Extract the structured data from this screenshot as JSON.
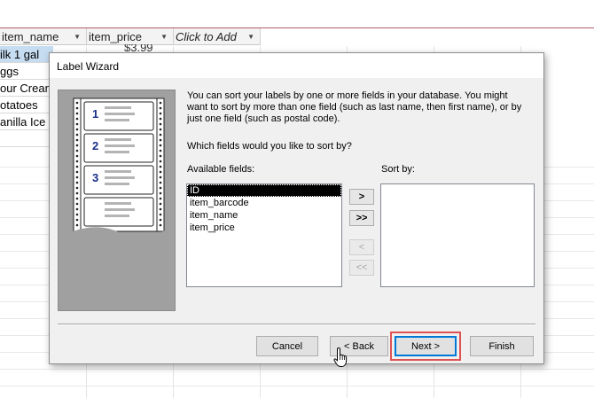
{
  "datasheet": {
    "columns": [
      {
        "label": "item_name",
        "italic": false
      },
      {
        "label": "item_price",
        "italic": false
      },
      {
        "label": "Click to Add",
        "italic": true
      }
    ],
    "rows": [
      "ilk 1 gal",
      "ggs",
      "our Cream",
      "otatoes",
      "anilla Ice"
    ],
    "selected_row_index": 0,
    "partial_price": "$3.99"
  },
  "dialog": {
    "title": "Label Wizard",
    "instructions": "You can sort your labels by one or more fields in your database.  You might want to sort by more than one field (such as last name, then first name), or by just one field (such as postal code).",
    "question": "Which fields would you like to sort by?",
    "available_label": "Available fields:",
    "sort_label": "Sort by:",
    "available_fields": [
      "ID",
      "item_barcode",
      "item_name",
      "item_price"
    ],
    "selected_field_index": 0,
    "sort_fields": [],
    "move_buttons": {
      "add_one": ">",
      "add_all": ">>",
      "remove_one": "<",
      "remove_all": "<<"
    },
    "illustration_numbers": [
      "1",
      "2",
      "3"
    ],
    "buttons": {
      "cancel": "Cancel",
      "back": "< Back",
      "next": "Next >",
      "finish": "Finish"
    }
  },
  "colors": {
    "accent": "#0078d7",
    "highlight": "#e05252",
    "selection": "#c6dcf0"
  }
}
